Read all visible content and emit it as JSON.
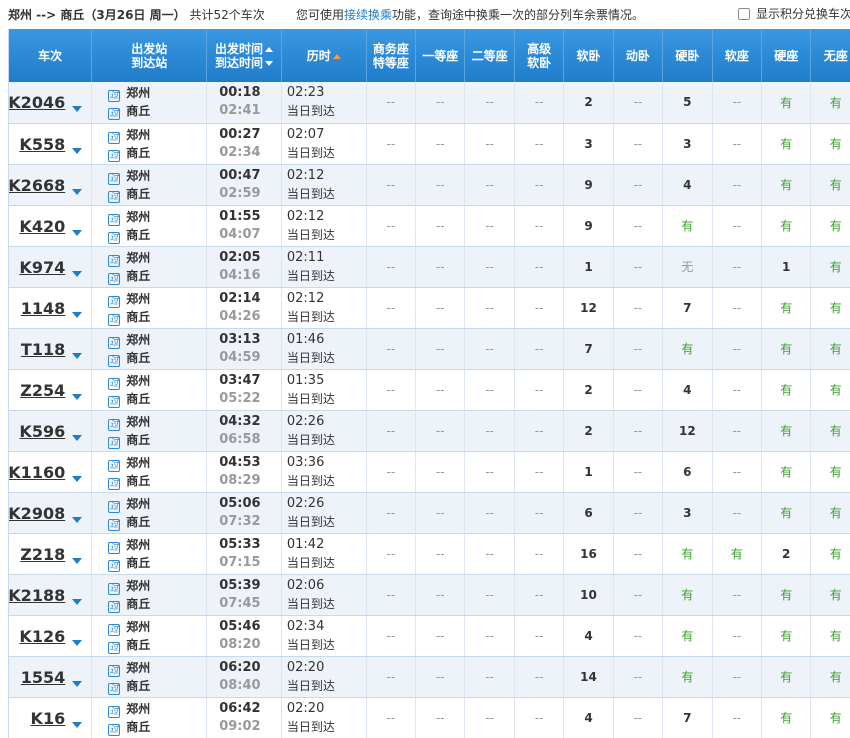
{
  "header": {
    "route": "郑州 --> 商丘（3月26日  周一）",
    "count_text": "共计52个车次",
    "tip_prefix": "您可使用",
    "tip_link": "接续换乘",
    "tip_suffix": "功能，查询途中换乘一次的部分列车余票情况。",
    "points_label": "显示积分兑换车次"
  },
  "columns": {
    "train": "车次",
    "stations_line1": "出发站",
    "stations_line2": "到达站",
    "times_line1": "出发时间",
    "times_line2": "到达时间",
    "duration": "历时",
    "business_line1": "商务座",
    "business_line2": "特等座",
    "first": "一等座",
    "second": "二等座",
    "deluxe_line1": "高级",
    "deluxe_line2": "软卧",
    "soft_sleeper": "软卧",
    "emu_sleeper": "动卧",
    "hard_sleeper": "硬卧",
    "soft_seat": "软座",
    "hard_seat": "硬座",
    "standing": "无座"
  },
  "station_badge": "过",
  "colors": {
    "header_blue": "#2a89d6",
    "yes_green": "#3aa12b",
    "link_blue": "#1e7ecf",
    "sort_orange": "#ff9a3c"
  },
  "trains": [
    {
      "code": "K2046",
      "from": "郑州",
      "to": "商丘",
      "dep": "00:18",
      "arr": "02:41",
      "dur": "02:23",
      "same": "当日到达",
      "seats": [
        "--",
        "--",
        "--",
        "--",
        "2",
        "--",
        "5",
        "--",
        "有",
        "有"
      ]
    },
    {
      "code": "K558",
      "from": "郑州",
      "to": "商丘",
      "dep": "00:27",
      "arr": "02:34",
      "dur": "02:07",
      "same": "当日到达",
      "seats": [
        "--",
        "--",
        "--",
        "--",
        "3",
        "--",
        "3",
        "--",
        "有",
        "有"
      ]
    },
    {
      "code": "K2668",
      "from": "郑州",
      "to": "商丘",
      "dep": "00:47",
      "arr": "02:59",
      "dur": "02:12",
      "same": "当日到达",
      "seats": [
        "--",
        "--",
        "--",
        "--",
        "9",
        "--",
        "4",
        "--",
        "有",
        "有"
      ]
    },
    {
      "code": "K420",
      "from": "郑州",
      "to": "商丘",
      "dep": "01:55",
      "arr": "04:07",
      "dur": "02:12",
      "same": "当日到达",
      "seats": [
        "--",
        "--",
        "--",
        "--",
        "9",
        "--",
        "有",
        "--",
        "有",
        "有"
      ]
    },
    {
      "code": "K974",
      "from": "郑州",
      "to": "商丘",
      "dep": "02:05",
      "arr": "04:16",
      "dur": "02:11",
      "same": "当日到达",
      "seats": [
        "--",
        "--",
        "--",
        "--",
        "1",
        "--",
        "无",
        "--",
        "1",
        "有"
      ]
    },
    {
      "code": "1148",
      "from": "郑州",
      "to": "商丘",
      "dep": "02:14",
      "arr": "04:26",
      "dur": "02:12",
      "same": "当日到达",
      "seats": [
        "--",
        "--",
        "--",
        "--",
        "12",
        "--",
        "7",
        "--",
        "有",
        "有"
      ]
    },
    {
      "code": "T118",
      "from": "郑州",
      "to": "商丘",
      "dep": "03:13",
      "arr": "04:59",
      "dur": "01:46",
      "same": "当日到达",
      "seats": [
        "--",
        "--",
        "--",
        "--",
        "7",
        "--",
        "有",
        "--",
        "有",
        "有"
      ]
    },
    {
      "code": "Z254",
      "from": "郑州",
      "to": "商丘",
      "dep": "03:47",
      "arr": "05:22",
      "dur": "01:35",
      "same": "当日到达",
      "seats": [
        "--",
        "--",
        "--",
        "--",
        "2",
        "--",
        "4",
        "--",
        "有",
        "有"
      ]
    },
    {
      "code": "K596",
      "from": "郑州",
      "to": "商丘",
      "dep": "04:32",
      "arr": "06:58",
      "dur": "02:26",
      "same": "当日到达",
      "seats": [
        "--",
        "--",
        "--",
        "--",
        "2",
        "--",
        "12",
        "--",
        "有",
        "有"
      ]
    },
    {
      "code": "K1160",
      "from": "郑州",
      "to": "商丘",
      "dep": "04:53",
      "arr": "08:29",
      "dur": "03:36",
      "same": "当日到达",
      "seats": [
        "--",
        "--",
        "--",
        "--",
        "1",
        "--",
        "6",
        "--",
        "有",
        "有"
      ]
    },
    {
      "code": "K2908",
      "from": "郑州",
      "to": "商丘",
      "dep": "05:06",
      "arr": "07:32",
      "dur": "02:26",
      "same": "当日到达",
      "seats": [
        "--",
        "--",
        "--",
        "--",
        "6",
        "--",
        "3",
        "--",
        "有",
        "有"
      ]
    },
    {
      "code": "Z218",
      "from": "郑州",
      "to": "商丘",
      "dep": "05:33",
      "arr": "07:15",
      "dur": "01:42",
      "same": "当日到达",
      "seats": [
        "--",
        "--",
        "--",
        "--",
        "16",
        "--",
        "有",
        "有",
        "2",
        "有"
      ]
    },
    {
      "code": "K2188",
      "from": "郑州",
      "to": "商丘",
      "dep": "05:39",
      "arr": "07:45",
      "dur": "02:06",
      "same": "当日到达",
      "seats": [
        "--",
        "--",
        "--",
        "--",
        "10",
        "--",
        "有",
        "--",
        "有",
        "有"
      ]
    },
    {
      "code": "K126",
      "from": "郑州",
      "to": "商丘",
      "dep": "05:46",
      "arr": "08:20",
      "dur": "02:34",
      "same": "当日到达",
      "seats": [
        "--",
        "--",
        "--",
        "--",
        "4",
        "--",
        "有",
        "--",
        "有",
        "有"
      ]
    },
    {
      "code": "1554",
      "from": "郑州",
      "to": "商丘",
      "dep": "06:20",
      "arr": "08:40",
      "dur": "02:20",
      "same": "当日到达",
      "seats": [
        "--",
        "--",
        "--",
        "--",
        "14",
        "--",
        "有",
        "--",
        "有",
        "有"
      ]
    },
    {
      "code": "K16",
      "from": "郑州",
      "to": "商丘",
      "dep": "06:42",
      "arr": "09:02",
      "dur": "02:20",
      "same": "当日到达",
      "seats": [
        "--",
        "--",
        "--",
        "--",
        "4",
        "--",
        "7",
        "--",
        "有",
        "有"
      ]
    }
  ]
}
